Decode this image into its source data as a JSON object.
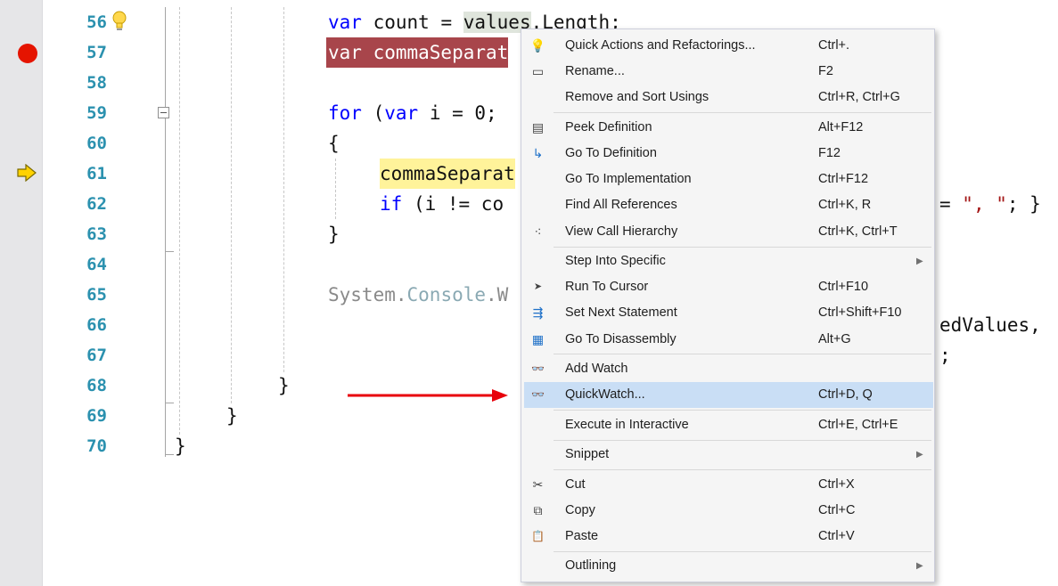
{
  "editor": {
    "line_numbers": [
      "56",
      "57",
      "58",
      "59",
      "60",
      "61",
      "62",
      "63",
      "64",
      "65",
      "66",
      "67",
      "68",
      "69",
      "70"
    ],
    "lines": {
      "l56": {
        "kw": "var",
        "a": " count = ",
        "hl": "values",
        "b": ".Length;"
      },
      "l57": {
        "text": "var commaSeparat"
      },
      "l59": {
        "kw_for": "for",
        "a": " (",
        "kw_var": "var",
        "b": " i = 0;"
      },
      "l60": {
        "text": "{"
      },
      "l61": {
        "text": "commaSeparat"
      },
      "l62": {
        "kw": "if",
        "text": " (i != co"
      },
      "l63": {
        "text": "}"
      },
      "l65": {
        "system": "System.",
        "console": "Console",
        "rest": ".W"
      },
      "l68": {
        "text": "}"
      },
      "l69": {
        "text": "}"
      },
      "l70": {
        "text": "}"
      }
    },
    "right_fragments": {
      "r62_eq": "= ",
      "r62_str": "\", \"",
      "r62_rest": "; }",
      "r66": "edValues,",
      "r67": ";"
    }
  },
  "context_menu": {
    "items": [
      {
        "label": "Quick Actions and Refactorings...",
        "shortcut": "Ctrl+.",
        "icon": "lightbulb-icon",
        "symbol": "💡"
      },
      {
        "label": "Rename...",
        "shortcut": "F2",
        "icon": "rename-icon",
        "symbol": "▭"
      },
      {
        "label": "Remove and Sort Usings",
        "shortcut": "Ctrl+R, Ctrl+G",
        "icon": "",
        "symbol": ""
      },
      {
        "label": "Peek Definition",
        "shortcut": "Alt+F12",
        "icon": "peek-definition-icon",
        "symbol": "▤"
      },
      {
        "label": "Go To Definition",
        "shortcut": "F12",
        "icon": "go-to-definition-icon",
        "symbol": "↳"
      },
      {
        "label": "Go To Implementation",
        "shortcut": "Ctrl+F12",
        "icon": "",
        "symbol": ""
      },
      {
        "label": "Find All References",
        "shortcut": "Ctrl+K, R",
        "icon": "",
        "symbol": ""
      },
      {
        "label": "View Call Hierarchy",
        "shortcut": "Ctrl+K, Ctrl+T",
        "icon": "call-hierarchy-icon",
        "symbol": "⁖"
      },
      {
        "label": "Step Into Specific",
        "shortcut": "",
        "icon": "",
        "symbol": "",
        "submenu": true
      },
      {
        "label": "Run To Cursor",
        "shortcut": "Ctrl+F10",
        "icon": "run-to-cursor-icon",
        "symbol": "➤"
      },
      {
        "label": "Set Next Statement",
        "shortcut": "Ctrl+Shift+F10",
        "icon": "set-next-statement-icon",
        "symbol": "⇶"
      },
      {
        "label": "Go To Disassembly",
        "shortcut": "Alt+G",
        "icon": "disassembly-icon",
        "symbol": "▦"
      },
      {
        "label": "Add Watch",
        "shortcut": "",
        "icon": "glasses-icon",
        "symbol": "👓"
      },
      {
        "label": "QuickWatch...",
        "shortcut": "Ctrl+D, Q",
        "icon": "glasses-icon",
        "symbol": "👓",
        "selected": true
      },
      {
        "label": "Execute in Interactive",
        "shortcut": "Ctrl+E, Ctrl+E",
        "icon": "",
        "symbol": ""
      },
      {
        "label": "Snippet",
        "shortcut": "",
        "icon": "",
        "symbol": "",
        "submenu": true
      },
      {
        "label": "Cut",
        "shortcut": "Ctrl+X",
        "icon": "scissors-icon",
        "symbol": "✂"
      },
      {
        "label": "Copy",
        "shortcut": "Ctrl+C",
        "icon": "copy-icon",
        "symbol": "⧉"
      },
      {
        "label": "Paste",
        "shortcut": "Ctrl+V",
        "icon": "paste-icon",
        "symbol": "📋"
      },
      {
        "label": "Outlining",
        "shortcut": "",
        "icon": "",
        "symbol": "",
        "submenu": true
      }
    ],
    "submenu_arrow": "▶"
  },
  "colors": {
    "breakpoint": "#e51400",
    "breakpoint_line": "#a8454b",
    "execution_line": "#fff39a",
    "arrow": "#e8000b",
    "menu_selected": "#c9def5",
    "line_numbers": "#2b91af",
    "keyword": "#0000ff"
  }
}
